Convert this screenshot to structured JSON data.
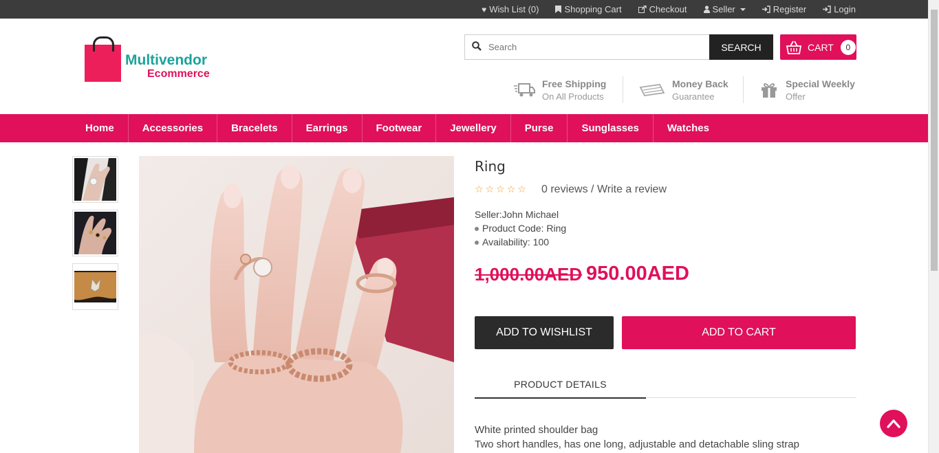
{
  "topbar": {
    "wishlist": "Wish List (0)",
    "cart": "Shopping Cart",
    "checkout": "Checkout",
    "seller": "Seller",
    "register": "Register",
    "login": "Login"
  },
  "logo": {
    "line1": "Multivendor",
    "line2": "Ecommerce"
  },
  "search": {
    "placeholder": "Search",
    "button": "SEARCH"
  },
  "cart": {
    "label": "CART",
    "count": "0"
  },
  "features": [
    {
      "title": "Free Shipping",
      "subtitle": "On All Products",
      "icon": "truck-icon"
    },
    {
      "title": "Money Back",
      "subtitle": "Guarantee",
      "icon": "money-icon"
    },
    {
      "title": "Special Weekly",
      "subtitle": "Offer",
      "icon": "gift-icon"
    }
  ],
  "nav": [
    "Home",
    "Accessories",
    "Bracelets",
    "Earrings",
    "Footwear",
    "Jewellery",
    "Purse",
    "Sunglasses",
    "Watches"
  ],
  "product": {
    "title": "Ring",
    "reviews": "0 reviews",
    "separator": "/",
    "write_review": "Write a review",
    "seller": "Seller:John Michael",
    "code": "Product Code: Ring",
    "availability": "Availability: 100",
    "old_price": "1,000.00AED",
    "new_price": "950.00AED",
    "rating": 0,
    "rating_max": 5
  },
  "buttons": {
    "wishlist": "ADD TO WISHLIST",
    "add_cart": "ADD TO CART"
  },
  "tabs": {
    "details": "PRODUCT DETAILS"
  },
  "description": {
    "line1": "White printed shoulder bag",
    "line2": "Two short handles, has one long, adjustable and detachable sling strap"
  },
  "colors": {
    "brand": "#e0105a",
    "dark": "#2b2b2b",
    "topbar": "#3c3c3c",
    "logo_teal": "#1ba39c"
  }
}
